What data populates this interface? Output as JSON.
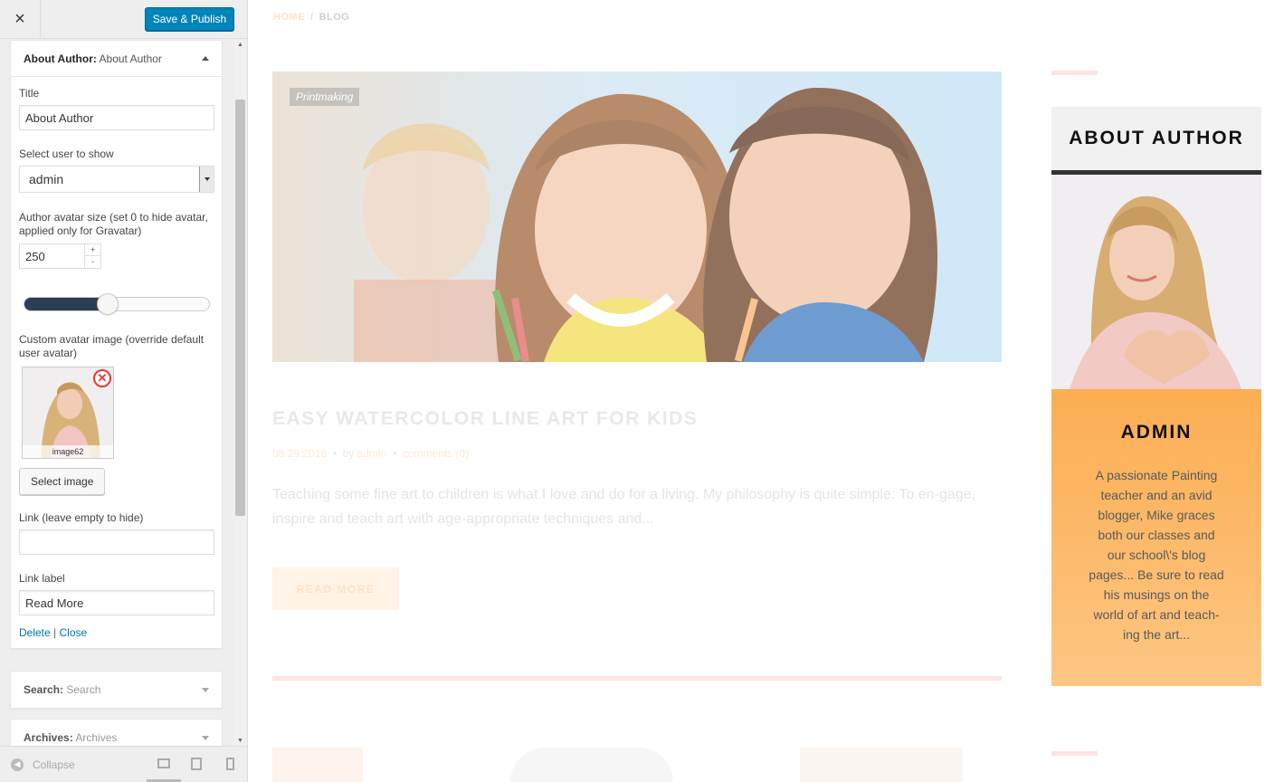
{
  "sidebar": {
    "close_icon": "×",
    "save_label": "Save & Publish",
    "widget": {
      "title": "About Author:",
      "subtitle": "About Author",
      "fields": {
        "title_label": "Title",
        "title_value": "About Author",
        "user_label": "Select user to show",
        "user_value": "admin",
        "avatar_size_label": "Author avatar size (set 0 to hide avatar, applied only for Gravatar)",
        "avatar_size_value": "250",
        "avatar_size_level": 0.45,
        "custom_avatar_label": "Custom avatar image (override default user avatar)",
        "image_name": "image62",
        "select_image_label": "Select image",
        "link_label": "Link (leave empty to hide)",
        "link_value": "",
        "link_label_label": "Link label",
        "link_label_value": "Read More"
      },
      "delete_label": "Delete",
      "separator": "|",
      "close_label": "Close"
    },
    "search_widget": {
      "title": "Search:",
      "subtitle": "Search"
    },
    "archives_widget": {
      "title": "Archives:",
      "subtitle": "Archives"
    },
    "collapse_label": "Collapse"
  },
  "preview": {
    "breadcrumb": {
      "home": "HOME",
      "sep": "/",
      "current": "BLOG"
    },
    "post": {
      "category": "Printmaking",
      "title": "EASY WATERCOLOR LINE ART FOR KIDS",
      "date": "08.29.2016",
      "by": "by",
      "author": "admin",
      "comments": "comments (0)",
      "excerpt": "Teaching some fine art to children is what I love and do for a living. My philosophy is quite simple: To en-gage, inspire and teach art with age-appropriate techniques and...",
      "read_more": "READ MORE"
    },
    "author_widget": {
      "heading": "ABOUT AUTHOR",
      "name": "ADMIN",
      "bio": "A passionate Painting teacher and an avid blogger, Mike graces both our classes and our school\\'s blog pages... Be sure to read his musings on the world of art and teach-ing the art..."
    }
  },
  "colors": {
    "primary_button": "#0085ba",
    "accent_orange": "#fcad52",
    "link_blue": "#0073aa"
  }
}
